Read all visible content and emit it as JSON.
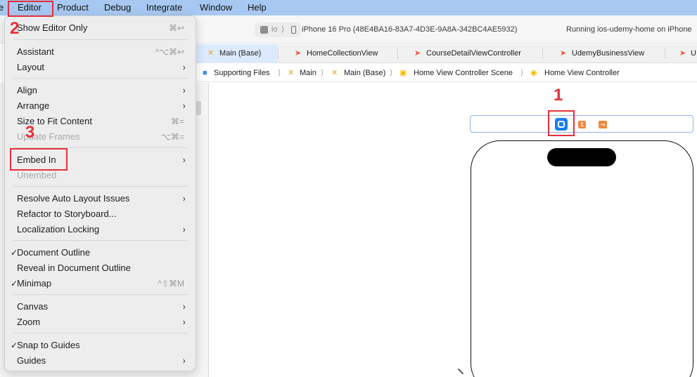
{
  "menubar": {
    "items": [
      "e",
      "Editor",
      "Product",
      "Debug",
      "Integrate",
      "Window",
      "Help"
    ]
  },
  "toolbar": {
    "scheme": {
      "label": "io",
      "chevron": "⟩"
    },
    "device": "iPhone 16 Pro (48E4BA16-83A7-4D3E-9A8A-342BC4AE5932)",
    "status": "Running ios-udemy-home on iPhone"
  },
  "tabs": [
    {
      "label": "Main (Base)",
      "icon": "storyboard-icon",
      "active": true
    },
    {
      "label": "HomeCollectionView",
      "icon": "swift-icon",
      "active": false
    },
    {
      "label": "CourseDetailViewController",
      "icon": "swift-icon",
      "active": false
    },
    {
      "label": "UdemyBusinessView",
      "icon": "swift-icon",
      "active": false
    },
    {
      "label": "U",
      "icon": "swift-icon",
      "active": false
    }
  ],
  "jumpbar": [
    {
      "label": "Supporting Files",
      "icon": "folder-icon"
    },
    {
      "label": "Main",
      "icon": "storyboard-icon"
    },
    {
      "label": "Main (Base)",
      "icon": "storyboard-icon"
    },
    {
      "label": "Home View Controller Scene",
      "icon": "scene-icon"
    },
    {
      "label": "Home View Controller",
      "icon": "view-controller-icon"
    }
  ],
  "jumpbar_separator": "⟩",
  "editor_menu": {
    "items": [
      {
        "label": "Show Editor Only",
        "shortcut": "⌘↩",
        "submenu": false,
        "disabled": false,
        "checked": false
      },
      {
        "label": "Assistant",
        "shortcut": "^⌥⌘↩",
        "submenu": false,
        "disabled": false,
        "checked": false
      },
      {
        "label": "Layout",
        "shortcut": "",
        "submenu": true,
        "disabled": false,
        "checked": false
      },
      {
        "label": "Align",
        "shortcut": "",
        "submenu": true,
        "disabled": false,
        "checked": false
      },
      {
        "label": "Arrange",
        "shortcut": "",
        "submenu": true,
        "disabled": false,
        "checked": false
      },
      {
        "label": "Size to Fit Content",
        "shortcut": "⌘=",
        "submenu": false,
        "disabled": false,
        "checked": false
      },
      {
        "label": "Update Frames",
        "shortcut": "⌥⌘=",
        "submenu": false,
        "disabled": true,
        "checked": false
      },
      {
        "label": "Embed In",
        "shortcut": "",
        "submenu": true,
        "disabled": false,
        "checked": false
      },
      {
        "label": "Unembed",
        "shortcut": "",
        "submenu": false,
        "disabled": true,
        "checked": false
      },
      {
        "label": "Resolve Auto Layout Issues",
        "shortcut": "",
        "submenu": true,
        "disabled": false,
        "checked": false
      },
      {
        "label": "Refactor to Storyboard...",
        "shortcut": "",
        "submenu": false,
        "disabled": false,
        "checked": false
      },
      {
        "label": "Localization Locking",
        "shortcut": "",
        "submenu": true,
        "disabled": false,
        "checked": false
      },
      {
        "label": "Document Outline",
        "shortcut": "",
        "submenu": false,
        "disabled": false,
        "checked": true
      },
      {
        "label": "Reveal in Document Outline",
        "shortcut": "",
        "submenu": false,
        "disabled": false,
        "checked": false
      },
      {
        "label": "Minimap",
        "shortcut": "^⇧⌘M",
        "submenu": false,
        "disabled": false,
        "checked": true
      },
      {
        "label": "Canvas",
        "shortcut": "",
        "submenu": true,
        "disabled": false,
        "checked": false
      },
      {
        "label": "Zoom",
        "shortcut": "",
        "submenu": true,
        "disabled": false,
        "checked": false
      },
      {
        "label": "Snap to Guides",
        "shortcut": "",
        "submenu": false,
        "disabled": false,
        "checked": true
      },
      {
        "label": "Guides",
        "shortcut": "",
        "submenu": true,
        "disabled": false,
        "checked": false
      }
    ],
    "check_glyph": "✓",
    "arrow_glyph": "›"
  },
  "scene_dock": {
    "first_responder_glyph": "1",
    "exit_glyph": "⇥"
  },
  "annotations": {
    "step1": "1",
    "step2": "2",
    "step3": "3",
    "color": "#e5303b"
  },
  "colors": {
    "menubar": "#a7c8f1",
    "accent": "#1a7df5",
    "orange": "#f0883e"
  }
}
